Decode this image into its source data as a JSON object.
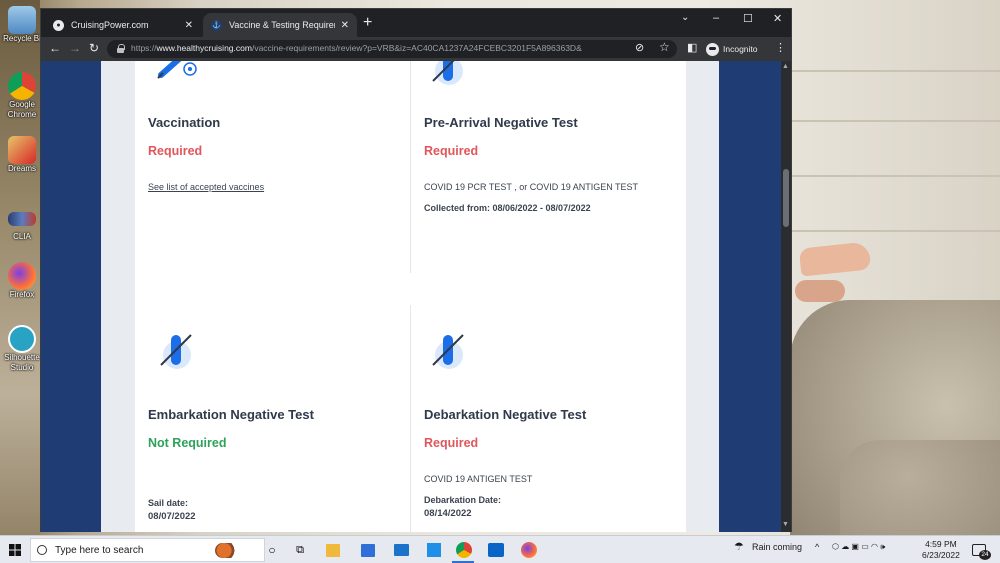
{
  "desktop": {
    "icons": [
      {
        "label": "Recycle Bi"
      },
      {
        "label": "Google Chrome"
      },
      {
        "label": "Dreams"
      },
      {
        "label": "CLIA"
      },
      {
        "label": "Firefox"
      },
      {
        "label": "Silhouette Studio"
      }
    ]
  },
  "browser": {
    "tabs": [
      {
        "title": "CruisingPower.com",
        "active": false
      },
      {
        "title": "Vaccine & Testing Requirements",
        "active": true
      }
    ],
    "new_tab": "+",
    "window_controls": {
      "minimize": "–",
      "maximize": "☐",
      "close": "✕",
      "tab_search": "⌄"
    },
    "url_prefix": "https://",
    "url_domain": "www.healthycruising.com",
    "url_rest": "/vaccine-requirements/review?p=VRB&iz=AC40CA1237A24FCEBC3201F5A896363D&",
    "incognito_label": "Incognito"
  },
  "page": {
    "cards": [
      {
        "title": "Vaccination",
        "status": "Required",
        "status_type": "required",
        "link": "See list of accepted vaccines"
      },
      {
        "title": "Pre-Arrival Negative Test",
        "status": "Required",
        "status_type": "required",
        "tests": "COVID 19 PCR TEST , or COVID 19 ANTIGEN TEST",
        "collected": "Collected from: 08/06/2022 - 08/07/2022"
      },
      {
        "title": "Embarkation Negative Test",
        "status": "Not Required",
        "status_type": "not-required",
        "date_label": "Sail date:",
        "date_value": "08/07/2022"
      },
      {
        "title": "Debarkation Negative Test",
        "status": "Required",
        "status_type": "required",
        "tests": "COVID 19 ANTIGEN TEST",
        "date_label": "Debarkation Date:",
        "date_value": "08/14/2022"
      }
    ]
  },
  "taskbar": {
    "search_placeholder": "Type here to search",
    "weather": "Rain coming",
    "time": "4:59 PM",
    "date": "6/23/2022",
    "notification_count": "24"
  },
  "colors": {
    "required": "#e0565b",
    "not_required": "#2ea15a",
    "page_bg": "#1f3d74",
    "icon_blue": "#1b6ee8"
  }
}
